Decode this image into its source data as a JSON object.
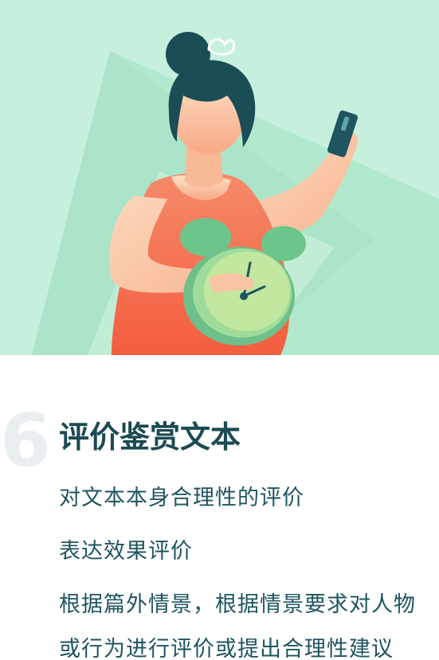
{
  "section": {
    "number": "6",
    "title": "评价鉴赏文本",
    "lines": [
      "对文本本身合理性的评价",
      "表达效果评价",
      "根据篇外情景，根据情景要求对人物",
      "或行为进行评价或提出合理性建议"
    ]
  },
  "illustration": {
    "background_color": "#c6f0dc",
    "accent_colors": {
      "hair": "#1a4d55",
      "skin": "#fbc9a8",
      "top": "#f46c4c",
      "clock": "#8fd59a",
      "phone": "#1f5560"
    },
    "icons": [
      "woman-figure",
      "alarm-clock-icon",
      "phone-icon",
      "hair-bow-icon"
    ]
  }
}
